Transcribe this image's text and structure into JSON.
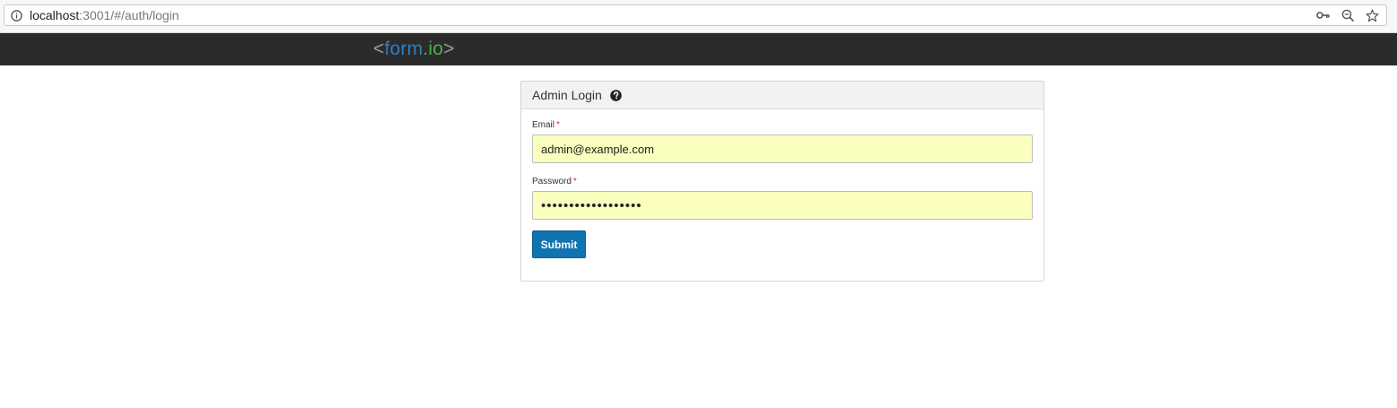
{
  "browser": {
    "url_host": "localhost",
    "url_path": ":3001/#/auth/login"
  },
  "nav": {
    "brand_open": "<",
    "brand_form": "form",
    "brand_dot": ".",
    "brand_io": "io",
    "brand_close": ">"
  },
  "login": {
    "title": "Admin Login",
    "email_label": "Email",
    "email_value": "admin@example.com",
    "password_label": "Password",
    "password_mask": "••••••••••••••••••",
    "required_marker": "*",
    "submit_label": "Submit"
  },
  "colors": {
    "nav_bg": "#2b2b2b",
    "brand_blue": "#2e7ec2",
    "brand_green": "#4aaf4a",
    "autofill_bg": "#faffbd",
    "submit_bg": "#1173b0"
  },
  "icons": {
    "address_left": "info-icon",
    "address_right": [
      "key-icon",
      "zoom-icon",
      "star-icon"
    ],
    "panel": "help-icon"
  }
}
